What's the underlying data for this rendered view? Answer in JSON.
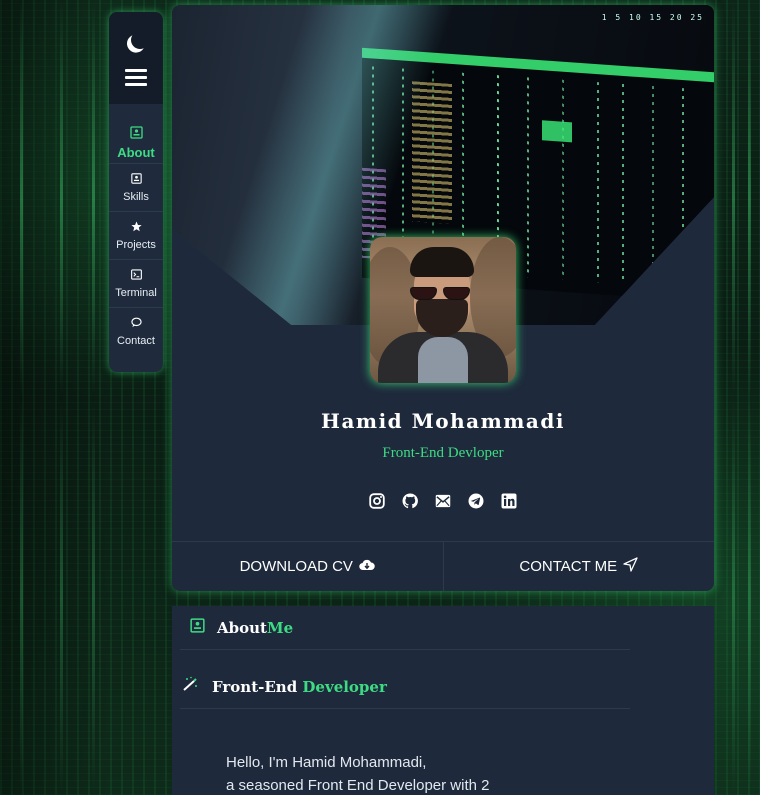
{
  "sidebar": {
    "theme_icon": "moon-icon",
    "menu_icon": "hamburger-icon",
    "items": [
      {
        "label": "About",
        "icon": "id-card-icon",
        "active": true
      },
      {
        "label": "Skills",
        "icon": "id-card-icon",
        "active": false
      },
      {
        "label": "Projects",
        "icon": "star-icon",
        "active": false
      },
      {
        "label": "Terminal",
        "icon": "terminal-icon",
        "active": false
      },
      {
        "label": "Contact",
        "icon": "chat-bubble-icon",
        "active": false
      }
    ]
  },
  "profile": {
    "name": "Hamid Mohammadi",
    "role": "Front-End Devloper",
    "socials": [
      "instagram-icon",
      "github-icon",
      "email-icon",
      "telegram-icon",
      "linkedin-icon"
    ],
    "download_label": "DOWNLOAD CV",
    "contact_label": "CONTACT ME"
  },
  "about": {
    "heading_a": "About",
    "heading_b": "Me",
    "sub_a": "Front-End",
    "sub_b": "Developer",
    "line1": "Hello, I'm Hamid Mohammadi,",
    "line2": "a seasoned Front End Developer with 2"
  },
  "colors": {
    "accent": "#3ddc84",
    "card": "#1e293b",
    "sidebar_top": "#141c29"
  }
}
